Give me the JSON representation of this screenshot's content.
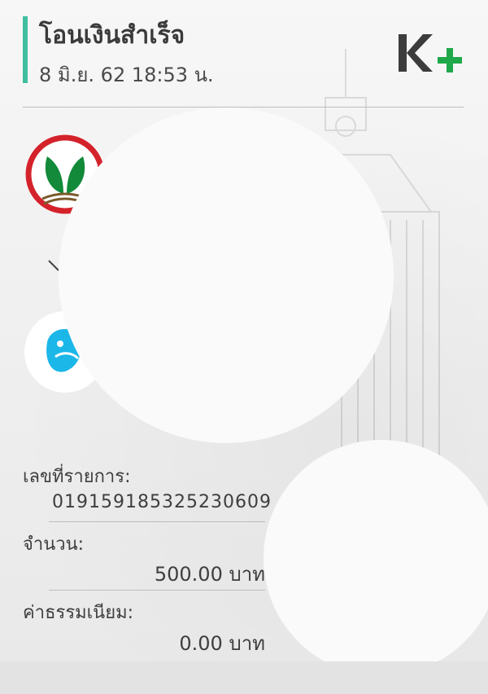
{
  "header": {
    "title": "โอนเงินสำเร็จ",
    "datetime": "8 มิ.ย. 62  18:53 น.",
    "brand_logo": "k-plus-logo",
    "accent_color": "#3fbfa0",
    "brand_color": "#1fa84a"
  },
  "transfer": {
    "from_bank_icon": "kasikornbank-logo",
    "to_bank_icon": "krungthai-bank-logo",
    "direction_icon": "arrow-down-icon"
  },
  "details": {
    "ref_label": "เลขที่รายการ:",
    "ref_value": "019159185325230609",
    "amount_label": "จำนวน:",
    "amount_value": "500.00 บาท",
    "fee_label": "ค่าธรรมเนียม:",
    "fee_value": "0.00 บาท"
  }
}
